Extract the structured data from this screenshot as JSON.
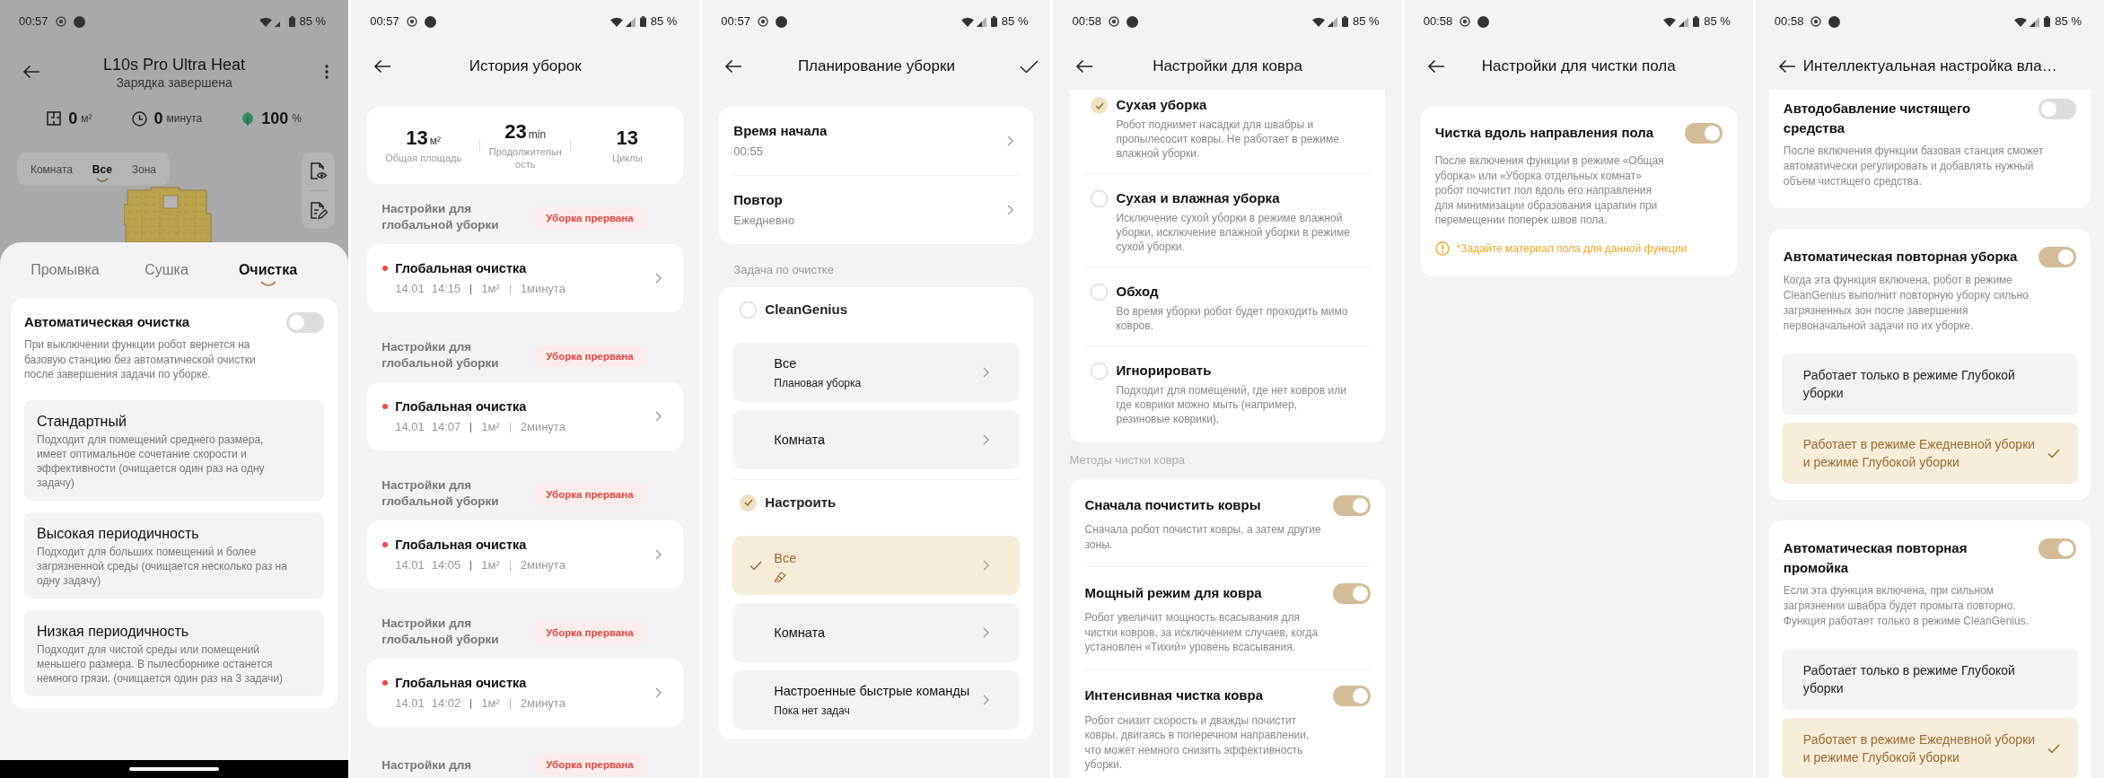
{
  "screens": [
    {
      "kind": "device",
      "status_bar": {
        "time": "00:57",
        "battery": "85 %"
      },
      "header": {
        "title": "L10s Pro Ultra Heat",
        "subtitle": "Зарядка завершена"
      },
      "stats": [
        {
          "kind": "area",
          "value": "0",
          "unit": "м²"
        },
        {
          "kind": "time",
          "value": "0",
          "unit": "минута"
        },
        {
          "kind": "charge",
          "value": "100",
          "unit": "%"
        }
      ],
      "map_modes": [
        {
          "label": "Комната",
          "selected": false
        },
        {
          "label": "Все",
          "selected": true
        },
        {
          "label": "Зона",
          "selected": false
        }
      ],
      "sheet": {
        "tabs": [
          {
            "label": "Промывка",
            "selected": false
          },
          {
            "label": "Сушка",
            "selected": false
          },
          {
            "label": "Очистка",
            "selected": true
          }
        ],
        "setting": {
          "title": "Автоматическая очистка",
          "on": false,
          "description": "При выключении функции робот вернется на базовую станцию без автоматической очистки после завершения задачи по уборке."
        },
        "options": [
          {
            "title": "Стандартный",
            "description": "Подходит для помещений среднего размера, имеет оптимальное сочетание скорости и эффективности (очищается один раз на одну задачу)"
          },
          {
            "title": "Высокая периодичность",
            "description": "Подходит для больших помещений и более загрязненной среды (очищается несколько раз на одну задачу)"
          },
          {
            "title": "Низкая периодичность",
            "description": "Подходит для чистой среды или помещений меньшего размера. В пылесборнике останется немного грязи. (очищается один раз на 3 задачи)"
          }
        ]
      }
    },
    {
      "kind": "history",
      "status_bar": {
        "time": "00:57",
        "battery": "85 %"
      },
      "header": {
        "title": "История уборок"
      },
      "summary": [
        {
          "value": "13",
          "unit": "м²",
          "label": "Общая площадь"
        },
        {
          "value": "23",
          "unit": "min",
          "label": "Продолжительность"
        },
        {
          "value": "13",
          "label": "Циклы"
        }
      ],
      "groups": [
        {
          "heading": "Настройки для глобальной уборки",
          "badge": "Уборка прервана",
          "record": {
            "title": "Глобальная очистка",
            "date": "14.01",
            "time": "14:15",
            "area": "1м²",
            "duration": "1минута"
          }
        },
        {
          "heading": "Настройки для глобальной уборки",
          "badge": "Уборка прервана",
          "record": {
            "title": "Глобальная очистка",
            "date": "14.01",
            "time": "14:07",
            "area": "1м²",
            "duration": "2минута"
          }
        },
        {
          "heading": "Настройки для глобальной уборки",
          "badge": "Уборка прервана",
          "record": {
            "title": "Глобальная очистка",
            "date": "14.01",
            "time": "14:05",
            "area": "1м²",
            "duration": "2минута"
          }
        },
        {
          "heading": "Настройки для глобальной уборки",
          "badge": "Уборка прервана",
          "record": {
            "title": "Глобальная очистка",
            "date": "14.01",
            "time": "14:02",
            "area": "1м²",
            "duration": "2минута"
          }
        },
        {
          "heading": "Настройки для",
          "badge": "Уборка прервана"
        }
      ]
    },
    {
      "kind": "schedule",
      "status_bar": {
        "time": "00:57",
        "battery": "85 %"
      },
      "header": {
        "title": "Планирование уборки"
      },
      "schedule": [
        {
          "title": "Время начала",
          "value": "00:55"
        },
        {
          "title": "Повтор",
          "value": "Ежедневно"
        }
      ],
      "section_label": "Задача по очистке",
      "task_groups": [
        {
          "label": "CleanGenius",
          "selected": false,
          "options": [
            {
              "kind": "detail",
              "title": "Все",
              "subtitle": "Плановая уборка",
              "selected": false
            },
            {
              "kind": "plain",
              "title": "Комната",
              "selected": false
            }
          ]
        },
        {
          "label": "Настроить",
          "selected": true,
          "options": [
            {
              "kind": "mode",
              "title": "Все",
              "selected": true
            },
            {
              "kind": "plain",
              "title": "Комната",
              "selected": false
            },
            {
              "kind": "detail",
              "title": "Настроенные быстрые команды",
              "subtitle": "Пока нет задач",
              "selected": false
            }
          ]
        }
      ]
    },
    {
      "kind": "carpet",
      "status_bar": {
        "time": "00:58",
        "battery": "85 %"
      },
      "header": {
        "title": "Настройки для ковра"
      },
      "modes": [
        {
          "title": "Сухая уборка",
          "description": "Робот поднимет насадки для швабры и пропылесосит ковры. Не работает в режиме влажной уборки.",
          "selected": true
        },
        {
          "title": "Сухая и влажная уборка",
          "description": "Исключение сухой уборки в режиме влажной уборки, исключение влажной уборки в режиме сухой уборки.",
          "selected": false
        },
        {
          "title": "Обход",
          "description": "Во время уборки робот будет проходить мимо ковров.",
          "selected": false
        },
        {
          "title": "Игнорировать",
          "description": "Подходит для помещений, где нет ковров или где коврики можно мыть (например, резиновые коврики).",
          "selected": false
        }
      ],
      "section_label": "Методы чистки ковра",
      "toggles": [
        {
          "title": "Сначала почистить ковры",
          "on": true,
          "description": "Сначала робот почистит ковры, а затем другие зоны."
        },
        {
          "title": "Мощный режим для ковра",
          "on": true,
          "description": "Робот увеличит мощность всасывания для чистки ковров, за исключением случаев, когда установлен «Тихий» уровень всасывания."
        },
        {
          "title": "Интенсивная чистка ковра",
          "on": true,
          "description": "Робот снизит скорость и дважды почистит ковры, двигаясь в поперечном направлении, что может немного снизить эффективность уборки."
        }
      ]
    },
    {
      "kind": "floor",
      "status_bar": {
        "time": "00:58",
        "battery": "85 %"
      },
      "header": {
        "title": "Настройки для чистки пола"
      },
      "setting": {
        "title": "Чистка вдоль направления пола",
        "on": true,
        "description": "После включения функции в режиме «Общая уборка» или «Уборка отдельных комнат» робот почистит пол вдоль его направления для минимизации образования царапин при перемещении поперек швов пола.",
        "warning": "*Задайте материал пола для данной функции"
      }
    },
    {
      "kind": "smart",
      "status_bar": {
        "time": "00:58",
        "battery": "85 %"
      },
      "header": {
        "title": "Интеллектуальная настройка вла…"
      },
      "cards": [
        {
          "title": "Автодобавление чистящего средства",
          "on": false,
          "description": "После включения функции базовая станция сможет автоматически регулировать и добавлять нужный объем чистящего средства."
        },
        {
          "title": "Автоматическая повторная уборка",
          "on": true,
          "description": "Когда эта функция включена, робот в режиме CleanGenius выполнит повторную уборку сильно загрязненных зон после завершения первоначальной задачи по их уборке.",
          "options": [
            {
              "label": "Работает только в режиме Глубокой уборки",
              "selected": false
            },
            {
              "label": "Работает в режиме Ежедневной уборки и режиме Глубокой уборки",
              "selected": true
            }
          ]
        },
        {
          "title": "Автоматическая повторная промойка",
          "on": true,
          "description": "Если эта функция включена, при сильном загрязнении швабра будет промыта повторно. Функция работает только в режиме CleanGenius.",
          "options": [
            {
              "label": "Работает только в режиме Глубокой уборки",
              "selected": false
            },
            {
              "label": "Работает в режиме Ежедневной уборки и режиме Глубокой уборки",
              "selected": true
            }
          ]
        }
      ]
    }
  ]
}
